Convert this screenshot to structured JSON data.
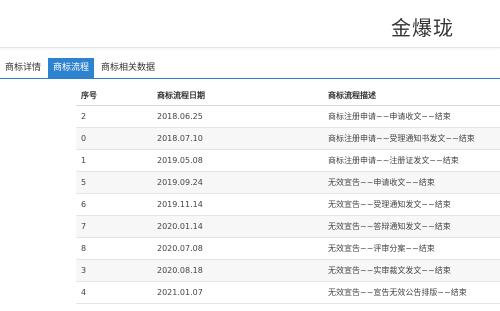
{
  "header": {
    "brand": "金爆珑"
  },
  "tabs": [
    {
      "label": "商标详情",
      "active": false
    },
    {
      "label": "商标流程",
      "active": true
    },
    {
      "label": "商标相关数据",
      "active": false
    }
  ],
  "table": {
    "columns": [
      "序号",
      "商标流程日期",
      "商标流程描述"
    ],
    "rows": [
      [
        "2",
        "2018.06.25",
        "商标注册申请~~申请收文~~结束"
      ],
      [
        "0",
        "2018.07.10",
        "商标注册申请~~受理通知书发文~~结束"
      ],
      [
        "1",
        "2019.05.08",
        "商标注册申请~~注册证发文~~结束"
      ],
      [
        "5",
        "2019.09.24",
        "无效宣告~~申请收文~~结束"
      ],
      [
        "6",
        "2019.11.14",
        "无效宣告~~受理通知发文~~结束"
      ],
      [
        "7",
        "2020.01.14",
        "无效宣告~~答辩通知发文~~结束"
      ],
      [
        "8",
        "2020.07.08",
        "无效宣告~~评审分案~~结束"
      ],
      [
        "3",
        "2020.08.18",
        "无效宣告~~实审裁文发文~~结束"
      ],
      [
        "4",
        "2021.01.07",
        "无效宣告~~宣告无效公告排版~~结束"
      ]
    ]
  }
}
